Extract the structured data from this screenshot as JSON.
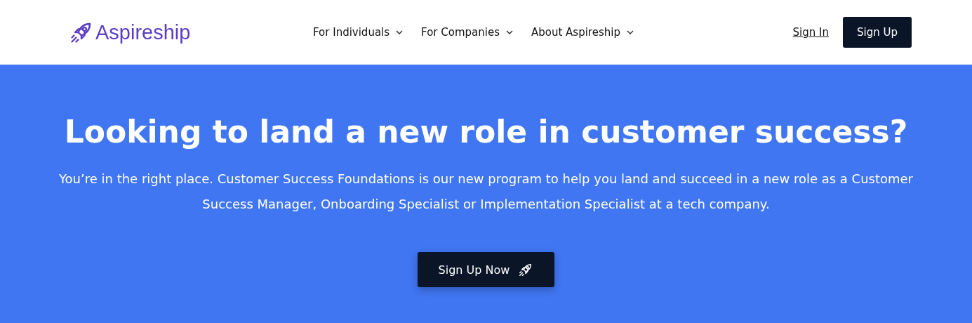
{
  "header": {
    "logo": "Aspireship",
    "nav": [
      {
        "label": "For Individuals"
      },
      {
        "label": "For Companies"
      },
      {
        "label": "About Aspireship"
      }
    ],
    "sign_in": "Sign In",
    "sign_up": "Sign Up"
  },
  "hero": {
    "title": "Looking to land a new role in customer success?",
    "text": "You’re in the right place. Customer Success Foundations is our new program to help you land and succeed in a new role as a Customer Success Manager, Onboarding Specialist or Implementation Specialist at a tech company.",
    "button": "Sign Up Now"
  }
}
